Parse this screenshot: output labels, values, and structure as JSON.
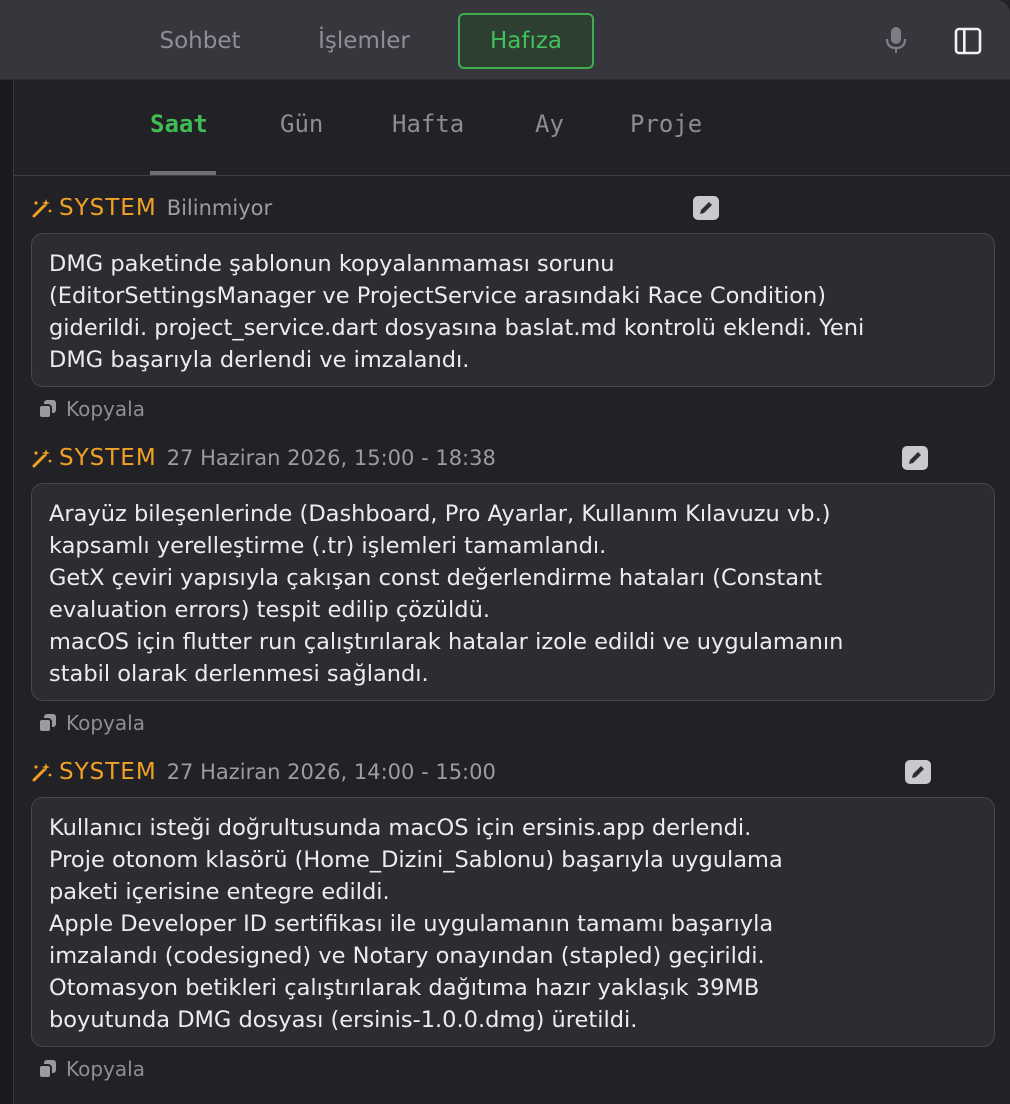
{
  "top_nav": {
    "tabs": [
      {
        "label": "Sohbet",
        "active": false
      },
      {
        "label": "İşlemler",
        "active": false
      },
      {
        "label": "Hafıza",
        "active": true
      }
    ],
    "icons": [
      "microphone-icon",
      "sidebar-toggle-icon"
    ]
  },
  "sub_nav": {
    "tabs": [
      {
        "label": "Saat",
        "active": true
      },
      {
        "label": "Gün",
        "active": false
      },
      {
        "label": "Hafta",
        "active": false
      },
      {
        "label": "Ay",
        "active": false
      },
      {
        "label": "Proje",
        "active": false
      }
    ]
  },
  "entries": [
    {
      "source": "SYSTEM",
      "date": "Bilinmiyor",
      "lines": [
        "DMG paketinde şablonun kopyalanmaması sorunu",
        "(EditorSettingsManager ve ProjectService arasındaki Race Condition)",
        "giderildi. project_service.dart dosyasına baslat.md kontrolü eklendi. Yeni",
        "DMG başarıyla derlendi ve imzalandı."
      ],
      "copy_label": "Kopyala"
    },
    {
      "source": "SYSTEM",
      "date": "27 Haziran 2026, 15:00 - 18:38",
      "lines": [
        "Arayüz bileşenlerinde (Dashboard, Pro Ayarlar, Kullanım Kılavuzu vb.)",
        "kapsamlı yerelleştirme (.tr) işlemleri tamamlandı.",
        "GetX çeviri yapısıyla çakışan const değerlendirme hataları (Constant",
        "evaluation errors) tespit edilip çözüldü.",
        "macOS için flutter run çalıştırılarak hatalar izole edildi ve uygulamanın",
        "stabil olarak derlenmesi sağlandı."
      ],
      "copy_label": "Kopyala"
    },
    {
      "source": "SYSTEM",
      "date": "27 Haziran 2026, 14:00 - 15:00",
      "lines": [
        "Kullanıcı isteği doğrultusunda macOS için ersinis.app derlendi.",
        "Proje otonom klasörü (Home_Dizini_Sablonu) başarıyla uygulama",
        "paketi içerisine entegre edildi.",
        "Apple Developer ID sertifikası ile uygulamanın tamamı başarıyla",
        "imzalandı (codesigned) ve Notary onayından (stapled) geçirildi.",
        "Otomasyon betikleri çalıştırılarak dağıtıma hazır yaklaşık 39MB",
        "boyutunda DMG dosyası (ersinis-1.0.0.dmg) üretildi."
      ],
      "copy_label": "Kopyala"
    }
  ],
  "colors": {
    "accent_green": "#3fbd52",
    "system_orange": "#f1a225",
    "background": "#222126",
    "card": "#2c2c33"
  }
}
